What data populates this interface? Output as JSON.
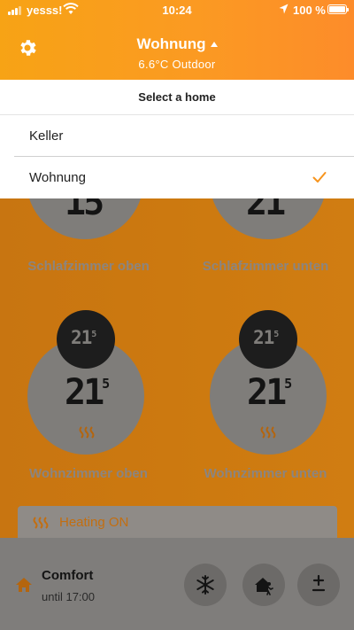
{
  "status_bar": {
    "carrier": "yesss!",
    "time": "10:24",
    "battery": "100 %"
  },
  "header": {
    "home_name": "Wohnung",
    "outdoor_temp": "6.6°C Outdoor"
  },
  "home_selector": {
    "title": "Select a home",
    "options": [
      {
        "label": "Keller",
        "selected": false
      },
      {
        "label": "Wohnung",
        "selected": true
      }
    ]
  },
  "rooms": [
    {
      "name": "Schlafzimmer oben",
      "temp_main": "15",
      "temp_sup": ""
    },
    {
      "name": "Schlafzimmer unten",
      "temp_main": "21",
      "temp_sup": ""
    },
    {
      "name": "Wohnzimmer oben",
      "target_main": "21",
      "target_sup": "5",
      "temp_main": "21",
      "temp_sup": "5",
      "heating": true
    },
    {
      "name": "Wohnzimmer unten",
      "target_main": "21",
      "target_sup": "5",
      "temp_main": "21",
      "temp_sup": "5",
      "heating": true
    }
  ],
  "heating_banner": {
    "text": "Heating ON"
  },
  "bottom_bar": {
    "mode": "Comfort",
    "until": "until 17:00"
  },
  "colors": {
    "accent": "#f7a315",
    "accent_dark": "#c87511",
    "check": "#f7941d"
  }
}
